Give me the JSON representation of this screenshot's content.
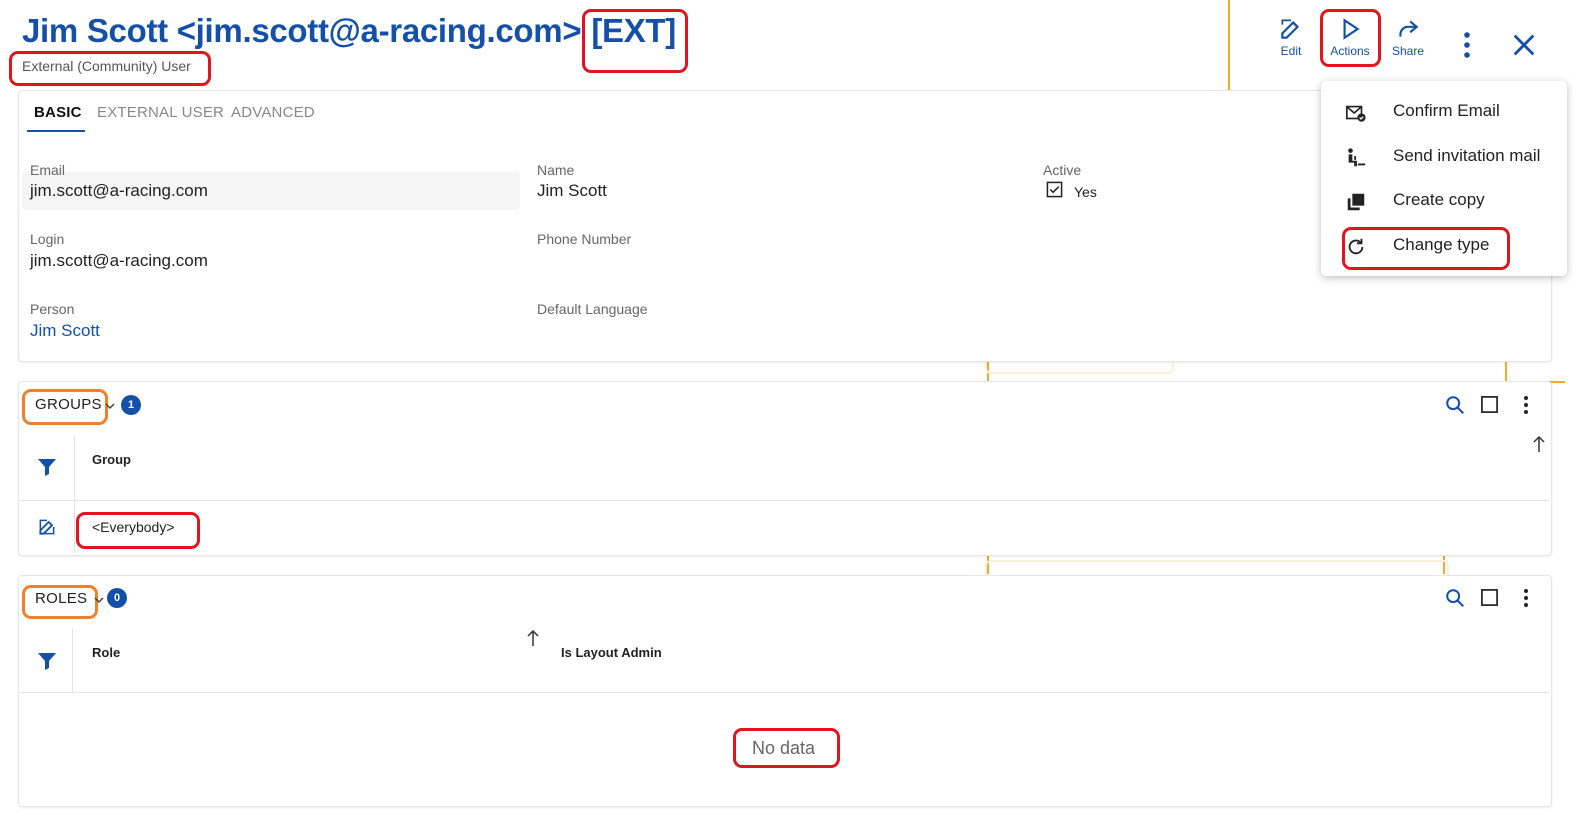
{
  "header": {
    "title": "Jim Scott <jim.scott@a-racing.com>",
    "title_suffix": "[EXT]",
    "subtitle": "External (Community) User"
  },
  "toolbar": {
    "edit_label": "Edit",
    "actions_label": "Actions",
    "share_label": "Share"
  },
  "tabs": [
    {
      "label": "BASIC",
      "active": true
    },
    {
      "label": "EXTERNAL USER",
      "active": false
    },
    {
      "label": "ADVANCED",
      "active": false
    }
  ],
  "fields": {
    "email": {
      "label": "Email",
      "value": "jim.scott@a-racing.com"
    },
    "name": {
      "label": "Name",
      "value": "Jim Scott"
    },
    "active": {
      "label": "Active",
      "value": "Yes",
      "checked": true
    },
    "login": {
      "label": "Login",
      "value": "jim.scott@a-racing.com"
    },
    "phone": {
      "label": "Phone Number",
      "value": ""
    },
    "person": {
      "label": "Person",
      "value": "Jim Scott"
    },
    "language": {
      "label": "Default Language",
      "value": ""
    }
  },
  "groups": {
    "title": "GROUPS",
    "count": "1",
    "columns": [
      "Group"
    ],
    "rows": [
      {
        "group": "<Everybody>"
      }
    ]
  },
  "roles": {
    "title": "ROLES",
    "count": "0",
    "columns": [
      "Role",
      "Is Layout Admin"
    ],
    "empty_text": "No data"
  },
  "actions_menu": {
    "items": [
      {
        "label": "Confirm Email",
        "icon": "confirm-email-icon"
      },
      {
        "label": "Send invitation mail",
        "icon": "send-invitation-icon"
      },
      {
        "label": "Create copy",
        "icon": "copy-icon"
      },
      {
        "label": "Change type",
        "icon": "refresh-icon"
      }
    ]
  },
  "colors": {
    "primary": "#1550a8",
    "highlight_red": "#e0151d",
    "highlight_orange": "#f0802a",
    "decor_orange": "#f3a92a"
  }
}
